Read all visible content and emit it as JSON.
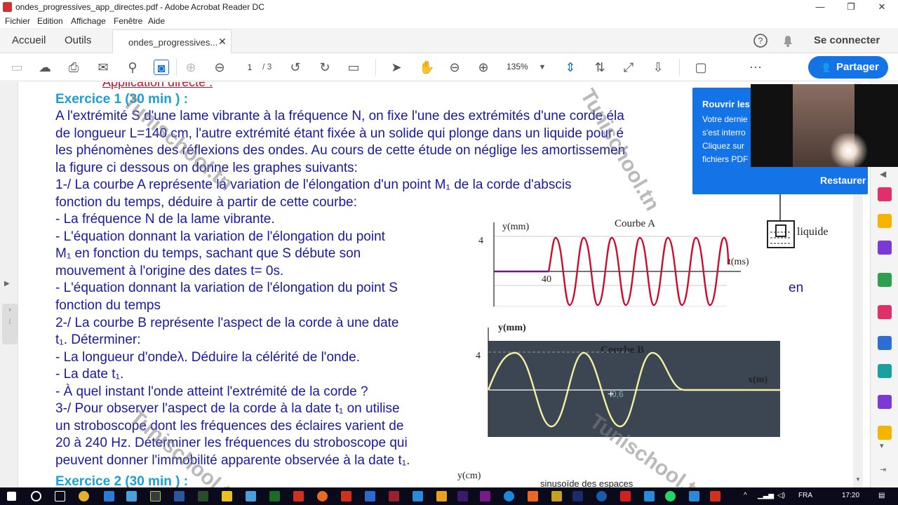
{
  "window": {
    "title": "ondes_progressives_app_directes.pdf - Adobe Acrobat Reader DC",
    "min": "—",
    "max": "❐",
    "close": "✕"
  },
  "menu": [
    "Fichier",
    "Edition",
    "Affichage",
    "Fenêtre",
    "Aide"
  ],
  "tabs": {
    "home": "Accueil",
    "tools": "Outils",
    "doc": "ondes_progressives...",
    "close": "✕",
    "signin": "Se connecter"
  },
  "toolbar": {
    "page_current": "1",
    "page_total": "/ 3",
    "zoom": "135%",
    "share": "Partager"
  },
  "document": {
    "heading_top": "Application directe :",
    "ex1_title": "Exercice 1",
    "ex1_time": " (30 min )  :",
    "lines": [
      "A l'extrémité S d'une lame vibrante à la fréquence N,  on fixe l'une des extrémités d'une corde éla",
      "de longueur L=140 cm, l'autre extrémité étant fixée à un solide qui plonge dans un liquide pour é",
      "les phénomènes des réflexions des ondes. Au cours de cette étude on néglige les amortissemen",
      "la figure  ci dessous on donne les graphes suivants:",
      " 1-/ La courbe A représente la variation de l'élongation d'un point M₁ de la corde d'abscis",
      "fonction du temps, déduire à partir de cette courbe:",
      "-     La fréquence N de la lame vibrante.",
      "-     L'équation donnant la variation de l'élongation du point",
      "       M₁ en fonction du temps, sachant que S débute son",
      "       mouvement à l'origine des dates t= 0s.",
      "-     L'équation donnant la variation de l'élongation du point S",
      "       fonction du temps",
      "2-/ La courbe B représente l'aspect de la corde à une date",
      "t₁. Déterminer:",
      "- La longueur d'ondeλ. Déduire la célérité de l'onde.",
      "- La date t₁.",
      "- À quel instant l'onde atteint l'extrémité de la corde ?",
      "3-/ Pour observer l'aspect de la corde à la date t₁ on utilise",
      "un stroboscope dont les fréquences des éclaires varient de",
      "20 à 240 Hz. Déterminer les fréquences du stroboscope qui",
      "peuvent donner l'immobilité apparente observée à la date t₁."
    ],
    "en_fragment": "en",
    "ex2_title": "Exercice 2",
    "ex2_time": " (30 min )  :",
    "liquide": "liquide",
    "ycm": "y(cm)",
    "sinusoide": "sinusoïde des espaces"
  },
  "curveA": {
    "title": "Courbe A",
    "ylabel": "y(mm)",
    "xlabel": "t(ms)",
    "y_tick": "4",
    "x_tick": "40"
  },
  "curveB": {
    "title": "Courbe B",
    "ylabel": "y(mm)",
    "xlabel": "x(m)",
    "y_tick": "4",
    "x_tick": "0,6"
  },
  "watermarks": [
    "Tunischool.tn",
    "Tunischool.tn",
    "Tunischool.tn",
    "Tunischool.tn"
  ],
  "popup": {
    "title": "Rouvrir les",
    "lines": [
      "Votre dernie",
      "s'est interro",
      "Cliquez sur",
      "fichiers PDF"
    ],
    "restore": "Restaurer"
  },
  "taskbar": {
    "lang": "FRA",
    "time": "17:20"
  },
  "colors": {
    "accent": "#1473e6",
    "doc_text": "#1a1aa0",
    "exercise": "#1aa0d8",
    "curveA": "#c8102e",
    "curveB": "#f4f0a0"
  }
}
